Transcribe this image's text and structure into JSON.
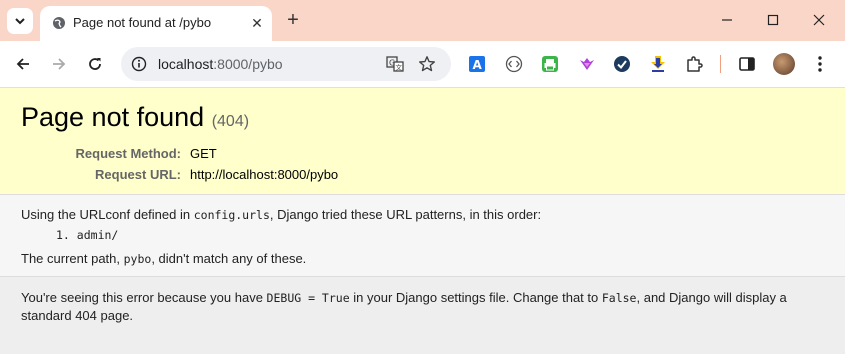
{
  "browser": {
    "tab_title": "Page not found at /pybo",
    "tab_close": "✕",
    "new_tab": "+",
    "url_host": "localhost",
    "url_rest": ":8000/pybo",
    "window_minimize": "—",
    "window_close": "✕"
  },
  "page": {
    "heading": "Page not found",
    "status_code": "(404)",
    "request_method_label": "Request Method:",
    "request_method_value": "GET",
    "request_url_label": "Request URL:",
    "request_url_value": "http://localhost:8000/pybo",
    "urlconf_prefix": "Using the URLconf defined in ",
    "urlconf_module": "config.urls",
    "urlconf_suffix": ", Django tried these URL patterns, in this order:",
    "patterns": [
      "admin/"
    ],
    "pattern_number": "1.",
    "current_path_prefix": "The current path, ",
    "current_path": "pybo",
    "current_path_suffix": ", didn't match any of these.",
    "explain_1": "You're seeing this error because you have ",
    "explain_debug": "DEBUG = True",
    "explain_2": " in your Django settings file. Change that to ",
    "explain_false": "False",
    "explain_3": ", and Django will display a standard 404 page."
  },
  "colors": {
    "tabstrip": "#f9d6c8",
    "summary_bg": "#ffffcc",
    "info_bg": "#f6f6f6",
    "explain_bg": "#eeeeee"
  },
  "icons": [
    "chevron-down-icon",
    "globe-icon",
    "close-icon",
    "plus-icon",
    "minimize-icon",
    "maximize-icon",
    "back-icon",
    "forward-icon",
    "reload-icon",
    "info-icon",
    "translate-icon",
    "star-icon",
    "ext-translate-a-icon",
    "ext-code-icon",
    "ext-printer-icon",
    "ext-feather-icon",
    "ext-check-icon",
    "ext-download-icon",
    "puzzle-icon",
    "sidepanel-icon",
    "avatar",
    "kebab-menu-icon"
  ]
}
